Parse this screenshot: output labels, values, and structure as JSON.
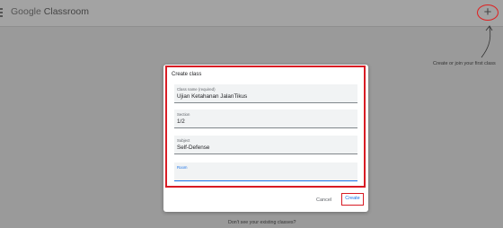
{
  "header": {
    "logo_brand": "Google",
    "logo_product": "Classroom",
    "add_button_label": "+"
  },
  "hint": "Create or join your first class",
  "dialog": {
    "title": "Create class",
    "fields": [
      {
        "label": "Class name (required)",
        "value": "Ujian Ketahanan JalanTikus"
      },
      {
        "label": "Section",
        "value": "1/2"
      },
      {
        "label": "Subject",
        "value": "Self-Defense"
      },
      {
        "label": "Room",
        "value": ""
      }
    ],
    "cancel_label": "Cancel",
    "create_label": "Create"
  },
  "footer_text": "Don't see your existing classes?",
  "colors": {
    "highlight": "#d81b24",
    "accent": "#1a73e8"
  }
}
